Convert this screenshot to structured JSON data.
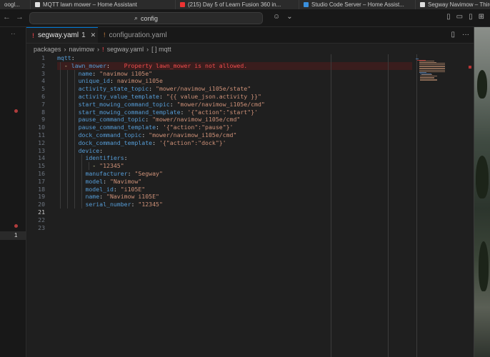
{
  "browser_tabs": [
    {
      "label": "oogl..."
    },
    {
      "label": "MQTT lawn mower – Home Assistant"
    },
    {
      "label": "(215) Day 5 of Learn Fusion 360 in..."
    },
    {
      "label": "Studio Code Server – Home Assist..."
    },
    {
      "label": "Segway Navimow – Third party int..."
    }
  ],
  "titlebar": {
    "nav_arrows": "← →",
    "search_text": "config",
    "search_icon": "magnifier-icon"
  },
  "activity_bar": {
    "more_label": "··",
    "badge_count": "1"
  },
  "editor_tabs": [
    {
      "label": "segway.yaml",
      "badge": "1",
      "close": "✕",
      "active": true
    },
    {
      "label": "configuration.yaml",
      "active": false
    }
  ],
  "tab_actions": {
    "split_icon": "split-editor-icon",
    "more": "···"
  },
  "breadcrumb": {
    "parts": [
      "packages",
      "navimow",
      "segway.yaml",
      "[ ] mqtt"
    ],
    "separator": "›"
  },
  "editor": {
    "line_numbers": [
      "1",
      "2",
      "3",
      "4",
      "5",
      "6",
      "7",
      "8",
      "9",
      "10",
      "11",
      "12",
      "13",
      "14",
      "15",
      "16",
      "17",
      "18",
      "19",
      "20",
      "21",
      "22",
      "23"
    ],
    "current_line": "21",
    "lines": [
      {
        "indent": "",
        "key": "mqtt",
        "colon": ":",
        "value": ""
      },
      {
        "indent": "  ",
        "dash": "- ",
        "key": "lawn_mower",
        "colon": ":",
        "value": "",
        "error": "    Property lawn_mower is not allowed."
      },
      {
        "indent": "      ",
        "key": "name",
        "colon": ": ",
        "value": "\"navimow i105e\""
      },
      {
        "indent": "      ",
        "key": "unique_id",
        "colon": ": ",
        "value": "navimow_i105e"
      },
      {
        "indent": "      ",
        "key": "activity_state_topic",
        "colon": ": ",
        "value": "\"mower/navimow_i105e/state\""
      },
      {
        "indent": "      ",
        "key": "activity_value_template",
        "colon": ": ",
        "value": "\"{{ value_json.activity }}\""
      },
      {
        "indent": "      ",
        "key": "start_mowing_command_topic",
        "colon": ": ",
        "value": "\"mower/navimow_i105e/cmd\""
      },
      {
        "indent": "      ",
        "key": "start_mowing_command_template",
        "colon": ": ",
        "value": "'{\"action\":\"start\"}'"
      },
      {
        "indent": "      ",
        "key": "pause_command_topic",
        "colon": ": ",
        "value": "\"mower/navimow_i105e/cmd\""
      },
      {
        "indent": "      ",
        "key": "pause_command_template",
        "colon": ": ",
        "value": "'{\"action\":\"pause\"}'"
      },
      {
        "indent": "      ",
        "key": "dock_command_topic",
        "colon": ": ",
        "value": "\"mower/navimow_i105e/cmd\""
      },
      {
        "indent": "      ",
        "key": "dock_command_template",
        "colon": ": ",
        "value": "'{\"action\":\"dock\"}'"
      },
      {
        "indent": "      ",
        "key": "device",
        "colon": ":",
        "value": ""
      },
      {
        "indent": "        ",
        "key": "identifiers",
        "colon": ":",
        "value": ""
      },
      {
        "indent": "          ",
        "dash": "- ",
        "key": "",
        "colon": "",
        "value": "\"12345\""
      },
      {
        "indent": "        ",
        "key": "manufacturer",
        "colon": ": ",
        "value": "\"Segway\""
      },
      {
        "indent": "        ",
        "key": "model",
        "colon": ": ",
        "value": "\"Navimow\""
      },
      {
        "indent": "        ",
        "key": "model_id",
        "colon": ": ",
        "value": "\"i105E\""
      },
      {
        "indent": "        ",
        "key": "name",
        "colon": ": ",
        "value": "\"Navimow i105E\""
      },
      {
        "indent": "        ",
        "key": "serial_number",
        "colon": ": ",
        "value": "\"12345\""
      },
      {
        "indent": "",
        "key": "",
        "colon": "",
        "value": ""
      },
      {
        "indent": "",
        "key": "",
        "colon": "",
        "value": ""
      },
      {
        "indent": "",
        "key": "",
        "colon": "",
        "value": ""
      }
    ]
  },
  "colors": {
    "accent": "#0078d4",
    "error": "#f14c4c",
    "yaml_key": "#569cd6",
    "yaml_string": "#ce9178"
  }
}
